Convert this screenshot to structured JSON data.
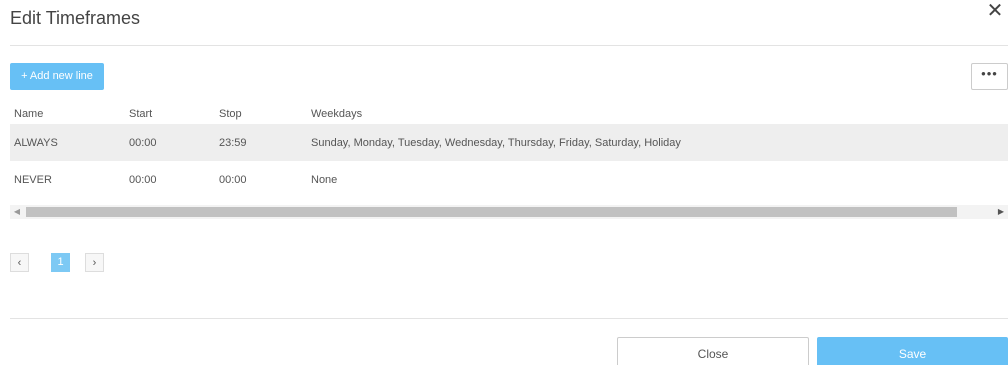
{
  "dialog": {
    "title": "Edit Timeframes",
    "close_icon": "close-icon"
  },
  "toolbar": {
    "add_label": "+ Add new line",
    "more_label": "•••"
  },
  "table": {
    "columns": [
      "Name",
      "Start",
      "Stop",
      "Weekdays"
    ],
    "rows": [
      {
        "name": "ALWAYS",
        "start": "00:00",
        "stop": "23:59",
        "weekdays": "Sunday, Monday, Tuesday, Wednesday, Thursday, Friday, Saturday, Holiday"
      },
      {
        "name": "NEVER",
        "start": "00:00",
        "stop": "00:00",
        "weekdays": "None"
      }
    ]
  },
  "scrollbar": {
    "left_arrow": "◀",
    "right_arrow": "▶"
  },
  "pagination": {
    "prev_label": "‹",
    "current_page": "1",
    "next_label": "›"
  },
  "footer": {
    "close_label": "Close",
    "save_label": "Save"
  },
  "colors": {
    "accent": "#67c0f5",
    "row_alt": "#eeeeee",
    "separator": "#e3e3e3"
  }
}
